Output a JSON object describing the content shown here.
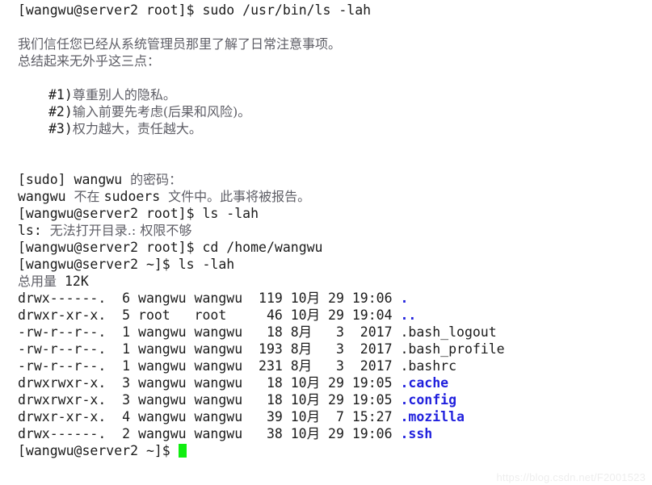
{
  "terminal": {
    "prompt_root": "[wangwu@server2 root]$ ",
    "prompt_home": "[wangwu@server2 ~]$ ",
    "commands": {
      "sudo_ls": "sudo /usr/bin/ls -lah",
      "ls_lah": "ls -lah",
      "cd_home": "cd /home/wangwu"
    },
    "sudo_lecture": {
      "line1": "我们信任您已经从系统管理员那里了解了日常注意事项。",
      "line2": "总结起来无外乎这三点：",
      "rules": [
        {
          "num": "#1)",
          "text": "尊重别人的隐私。"
        },
        {
          "num": "#2)",
          "text": "输入前要先考虑(后果和风险)。"
        },
        {
          "num": "#3)",
          "text": "权力越大，责任越大。"
        }
      ]
    },
    "password_prompt_ascii": "[sudo] wangwu ",
    "password_prompt_cjk": "的密码：",
    "not_sudoer": {
      "user": "wangwu ",
      "cjk1": "不在 ",
      "file": "sudoers ",
      "cjk2": "文件中。此事将被报告。"
    },
    "ls_error": {
      "prefix": "ls: ",
      "message": "无法打开目录.: 权限不够"
    },
    "total_label": "总用量",
    "total_value": "12K",
    "listing": [
      {
        "perms": "drwx------.",
        "links": "6",
        "owner": "wangwu",
        "group": "wangwu",
        "size": "119",
        "month": "10月",
        "day": "29",
        "time": "19:06",
        "name": ".",
        "is_dir": true
      },
      {
        "perms": "drwxr-xr-x.",
        "links": "5",
        "owner": "root",
        "group": "root",
        "size": "46",
        "month": "10月",
        "day": "29",
        "time": "19:04",
        "name": "..",
        "is_dir": true
      },
      {
        "perms": "-rw-r--r--.",
        "links": "1",
        "owner": "wangwu",
        "group": "wangwu",
        "size": "18",
        "month": "8月",
        "day": "3",
        "time": "2017",
        "name": ".bash_logout",
        "is_dir": false
      },
      {
        "perms": "-rw-r--r--.",
        "links": "1",
        "owner": "wangwu",
        "group": "wangwu",
        "size": "193",
        "month": "8月",
        "day": "3",
        "time": "2017",
        "name": ".bash_profile",
        "is_dir": false
      },
      {
        "perms": "-rw-r--r--.",
        "links": "1",
        "owner": "wangwu",
        "group": "wangwu",
        "size": "231",
        "month": "8月",
        "day": "3",
        "time": "2017",
        "name": ".bashrc",
        "is_dir": false
      },
      {
        "perms": "drwxrwxr-x.",
        "links": "3",
        "owner": "wangwu",
        "group": "wangwu",
        "size": "18",
        "month": "10月",
        "day": "29",
        "time": "19:05",
        "name": ".cache",
        "is_dir": true
      },
      {
        "perms": "drwxrwxr-x.",
        "links": "3",
        "owner": "wangwu",
        "group": "wangwu",
        "size": "18",
        "month": "10月",
        "day": "29",
        "time": "19:05",
        "name": ".config",
        "is_dir": true
      },
      {
        "perms": "drwxr-xr-x.",
        "links": "4",
        "owner": "wangwu",
        "group": "wangwu",
        "size": "39",
        "month": "10月",
        "day": "7",
        "time": "15:27",
        "name": ".mozilla",
        "is_dir": true
      },
      {
        "perms": "drwx------.",
        "links": "2",
        "owner": "wangwu",
        "group": "wangwu",
        "size": "38",
        "month": "10月",
        "day": "29",
        "time": "19:06",
        "name": ".ssh",
        "is_dir": true
      }
    ],
    "colors": {
      "background": "#ffffff",
      "foreground": "#1b1b1b",
      "cjk_foreground": "#5e5e66",
      "directory": "#1f1fdd",
      "cursor": "#10ee10",
      "watermark": "#eeeeee"
    }
  },
  "watermark": {
    "text": "https://blog.csdn.net/F2001523"
  }
}
